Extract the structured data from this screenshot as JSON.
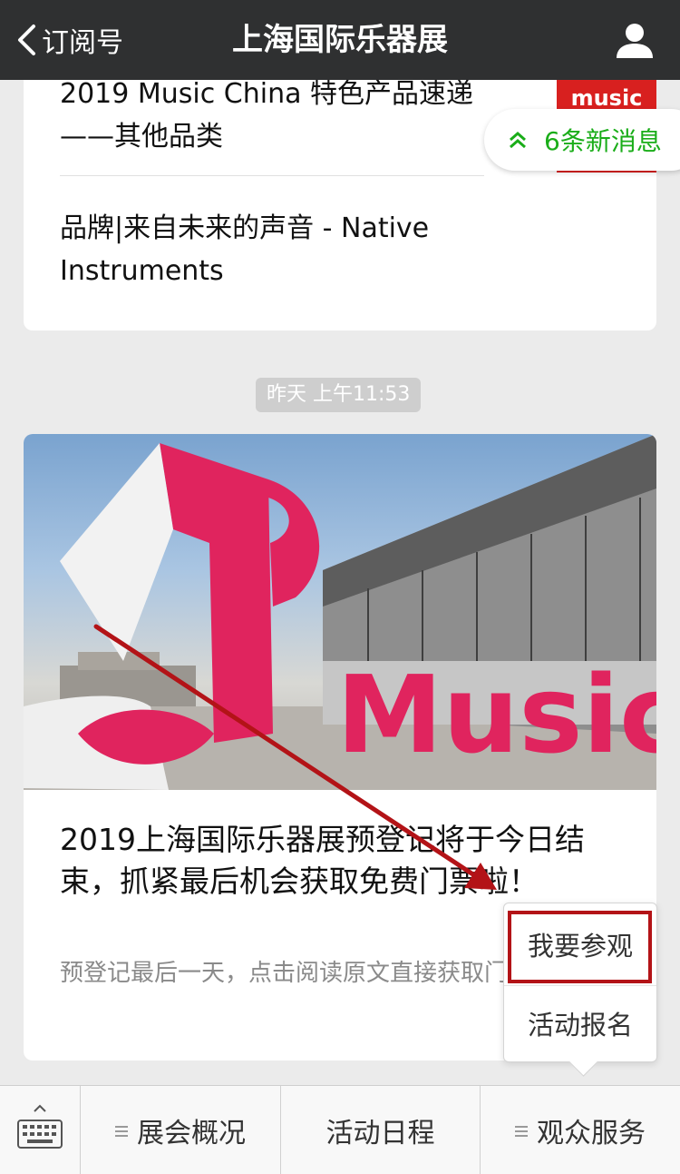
{
  "nav": {
    "back_label": "订阅号",
    "title": "上海国际乐器展"
  },
  "history": {
    "items": [
      {
        "title": "2019 Music China 特色产品速递——其他品类",
        "thumb_text": "music"
      },
      {
        "title": "品牌|来自未来的声音 - Native Instruments"
      }
    ]
  },
  "new_messages": {
    "label": "6条新消息"
  },
  "timestamp": "昨天 上午11:53",
  "article": {
    "title": "2019上海国际乐器展预登记将于今日结束，抓紧最后机会获取免费门票啦！",
    "digest": "预登记最后一天，点击阅读原文直接获取门票",
    "cover_text": "Music"
  },
  "popup_menu": {
    "items": [
      "我要参观",
      "活动报名"
    ]
  },
  "menu_bar": {
    "tabs": [
      "展会概况",
      "活动日程",
      "观众服务"
    ]
  },
  "colors": {
    "nav_bg": "#2f3031",
    "accent_green": "#1aad19",
    "brand_pink": "#e0245e",
    "annotation_red": "#b31317"
  }
}
